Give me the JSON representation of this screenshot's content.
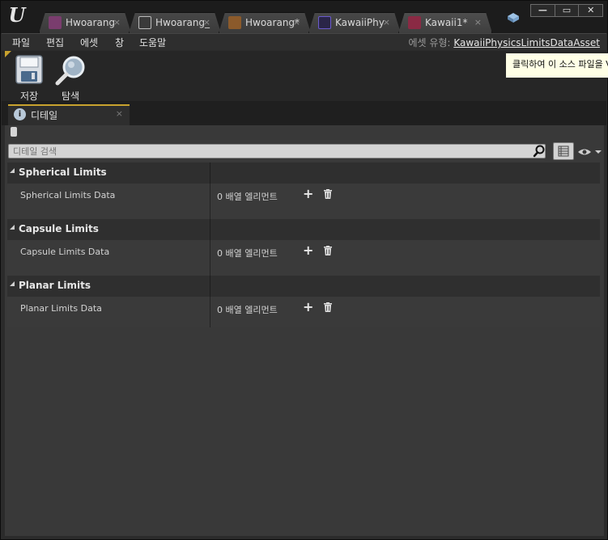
{
  "window": {
    "tabs": [
      {
        "label": "Hwoarang",
        "close": "×"
      },
      {
        "label": "Hwoarang_",
        "close": "×"
      },
      {
        "label": "Hwoarang*",
        "close": "×"
      },
      {
        "label": "KawaiiPhy",
        "close": "×"
      },
      {
        "label": "Kawaii1*",
        "close": "×"
      }
    ],
    "controls": {
      "minimize": "—",
      "maximize": "▭",
      "close": "✕"
    }
  },
  "menu": {
    "items": [
      "파일",
      "편집",
      "에셋",
      "창",
      "도움말"
    ],
    "asset_type_label": "에셋 유형:",
    "asset_type_value": "KawaiiPhysicsLimitsDataAsset"
  },
  "toolbar": {
    "save_label": "저장",
    "browse_label": "탐색",
    "tooltip": "클릭하여 이 소스 파일을 V"
  },
  "details": {
    "tab_label": "디테일",
    "tab_close": "×",
    "search_placeholder": "디테일 검색",
    "categories": [
      {
        "title": "Spherical Limits",
        "property": "Spherical Limits Data",
        "value": "0 배열 엘리먼트"
      },
      {
        "title": "Capsule Limits",
        "property": "Capsule Limits Data",
        "value": "0 배열 엘리먼트"
      },
      {
        "title": "Planar Limits",
        "property": "Planar Limits Data",
        "value": "0 배열 엘리먼트"
      }
    ]
  },
  "colors": {
    "accent": "#c8a22e",
    "panel": "#393939",
    "tooltip_bg": "#ffffe6"
  }
}
